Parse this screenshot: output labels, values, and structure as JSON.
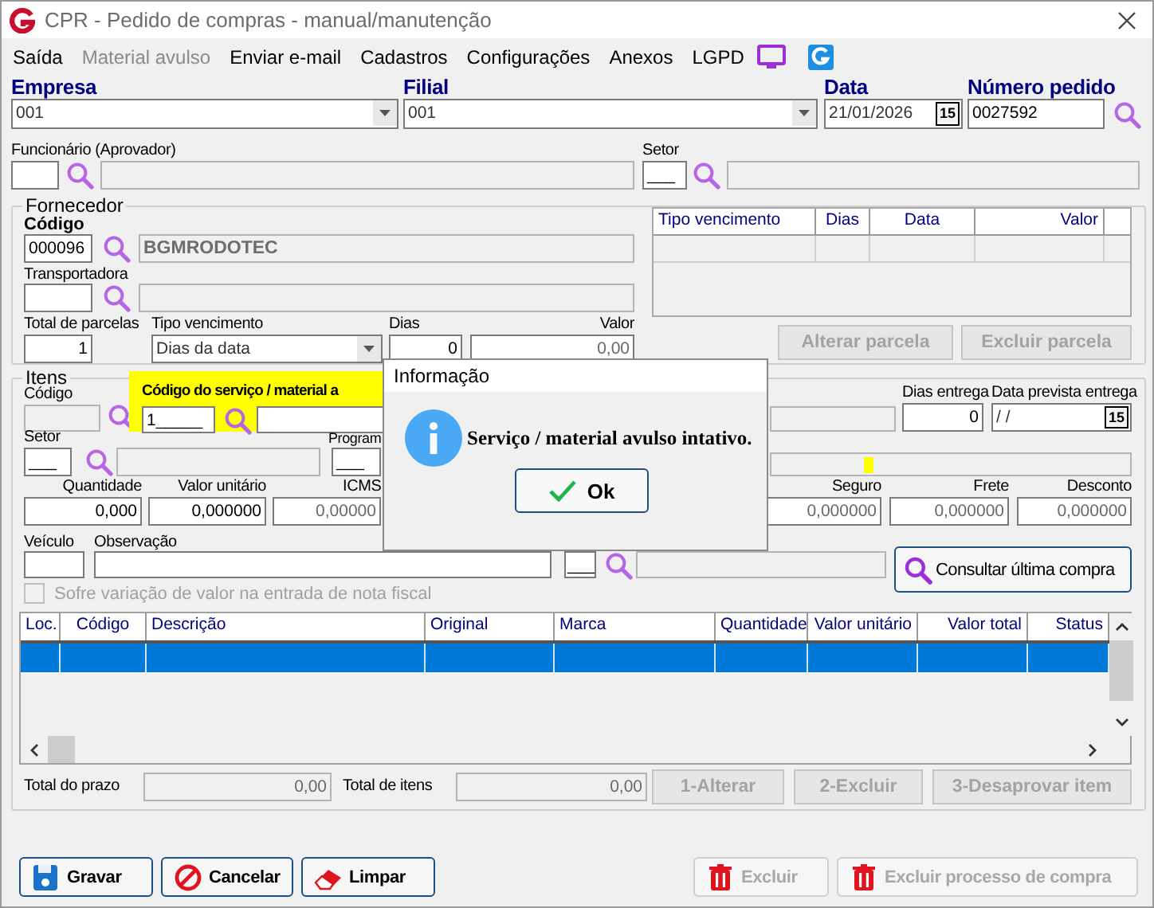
{
  "window": {
    "title": "CPR - Pedido de compras - manual/manutenção"
  },
  "menu": [
    {
      "label": "Saída",
      "disabled": false
    },
    {
      "label": "Material avulso",
      "disabled": true
    },
    {
      "label": "Enviar e-mail",
      "disabled": false
    },
    {
      "label": "Cadastros",
      "disabled": false
    },
    {
      "label": "Configurações",
      "disabled": false
    },
    {
      "label": "Anexos",
      "disabled": false
    },
    {
      "label": "LGPD",
      "disabled": false
    }
  ],
  "header": {
    "empresa": {
      "label": "Empresa",
      "value": "001"
    },
    "filial": {
      "label": "Filial",
      "value": "001"
    },
    "data": {
      "label": "Data",
      "value": "21/01/2026",
      "calendar": "15"
    },
    "numero_pedido": {
      "label": "Número pedido",
      "value": "0027592"
    }
  },
  "approver": {
    "funcionario_label": "Funcionário (Aprovador)",
    "setor_label": "Setor",
    "setor_value": "___"
  },
  "fornecedor": {
    "title": "Fornecedor",
    "codigo_label": "Código",
    "codigo": "000096",
    "nome": "BGMRODOTEC",
    "transportadora_label": "Transportadora",
    "total_parcelas_label": "Total de parcelas",
    "total_parcelas": "1",
    "tipo_vencimento_label": "Tipo vencimento",
    "tipo_vencimento": "Dias da data",
    "dias_label": "Dias",
    "dias": "0",
    "valor_label": "Valor",
    "valor": "0,00",
    "parcelas_columns": [
      "Tipo vencimento",
      "Dias",
      "Data",
      "Valor"
    ],
    "buttons": [
      {
        "label": "Alterar parcela",
        "disabled": true
      },
      {
        "label": "Excluir parcela",
        "disabled": true
      }
    ]
  },
  "itens": {
    "title": "Itens",
    "codigo_label": "Código",
    "servico_label": "Código do serviço / material a",
    "servico_code": "1_____",
    "dias_entrega_label": "Dias entrega",
    "dias_entrega": "0",
    "data_prevista_label": "Data prevista entrega",
    "data_prevista": "/ /",
    "calendar": "15",
    "setor_label": "Setor",
    "setor_value": "___",
    "programa_label": "Program",
    "programa_value": "___",
    "quantidade_label": "Quantidade",
    "quantidade": "0,000",
    "valor_unitario_label": "Valor unitário",
    "valor_unitario": "0,000000",
    "icms_label": "ICMS",
    "icms": "0,00000",
    "seguro_label": "Seguro",
    "seguro": "0,000000",
    "frete_label": "Frete",
    "frete": "0,000000",
    "desconto_label": "Desconto",
    "desconto": "0,000000",
    "veiculo_label": "Veículo",
    "observacao_label": "Observação",
    "obs_code": "___",
    "consultar_button": "Consultar última compra",
    "variation_checkbox": {
      "label": "Sofre variação de valor na entrada de nota fiscal",
      "checked": false,
      "disabled": true
    },
    "table": {
      "columns": [
        "Loc.",
        "Código",
        "Descrição",
        "Original",
        "Marca",
        "Quantidade",
        "Valor unitário",
        "Valor total",
        "Status"
      ],
      "rows": [
        {
          "selected": true
        }
      ]
    },
    "totals": {
      "prazo_label": "Total do prazo",
      "prazo": "0,00",
      "itens_label": "Total de itens",
      "itens": "0,00"
    },
    "buttons": [
      {
        "label": "1-Alterar",
        "disabled": true
      },
      {
        "label": "2-Excluir",
        "disabled": true
      },
      {
        "label": "3-Desaprovar item",
        "disabled": true
      }
    ]
  },
  "footer_buttons": [
    {
      "label": "Gravar",
      "kind": "save",
      "disabled": false
    },
    {
      "label": "Cancelar",
      "kind": "cancel",
      "disabled": false
    },
    {
      "label": "Limpar",
      "kind": "clear",
      "disabled": false
    },
    {
      "label": "Excluir",
      "kind": "delete",
      "disabled": true
    },
    {
      "label": "Excluir processo de compra",
      "kind": "delete",
      "disabled": true
    }
  ],
  "dialog": {
    "title": "Informação",
    "message": "Serviço / material avulso intativo.",
    "button": "Ok"
  }
}
